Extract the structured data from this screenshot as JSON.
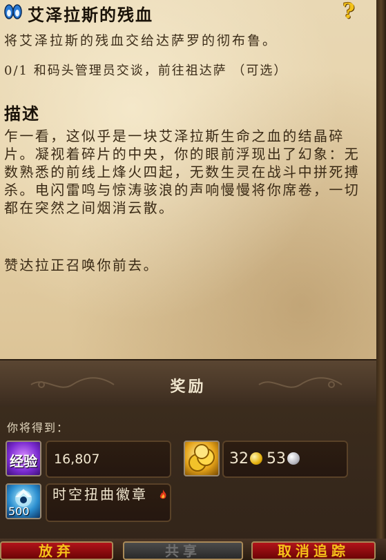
{
  "quest": {
    "title": "艾泽拉斯的残血",
    "summary": "将艾泽拉斯的残血交给达萨罗的彻布鲁。",
    "objective": "0/1 和码头管理员交谈，前往祖达萨 （可选）",
    "description_heading": "描述",
    "description": "乍一看，这似乎是一块艾泽拉斯生命之血的结晶碎片。凝视着碎片的中央，你的眼前浮现出了幻象：无数熟悉的前线上烽火四起，无数生灵在战斗中拼死搏杀。电闪雷鸣与惊涛骇浪的声响慢慢将你席卷，一切都在突然之间烟消云散。",
    "description_2": "赞达拉正召唤你前去。"
  },
  "rewards": {
    "banner_label": "奖励",
    "you_will_receive": "你将得到：",
    "xp_icon_label": "经验",
    "xp_value": "16,807",
    "money_gold": "32",
    "money_silver": "53",
    "token_count": "500",
    "token_name": "时空扭曲徽章"
  },
  "buttons": {
    "abandon": "放弃",
    "share": "共享",
    "untrack": "取消追踪"
  },
  "colors": {
    "parchment": "#e6d2aa",
    "button_red": "#b1141a",
    "button_text_gold": "#f6c21a"
  },
  "icons": {
    "quest": "quest-footprints-icon",
    "help": "question-mark-icon",
    "xp": "experience-icon",
    "money": "gold-coins-icon",
    "token": "timewarped-badge-icon"
  }
}
